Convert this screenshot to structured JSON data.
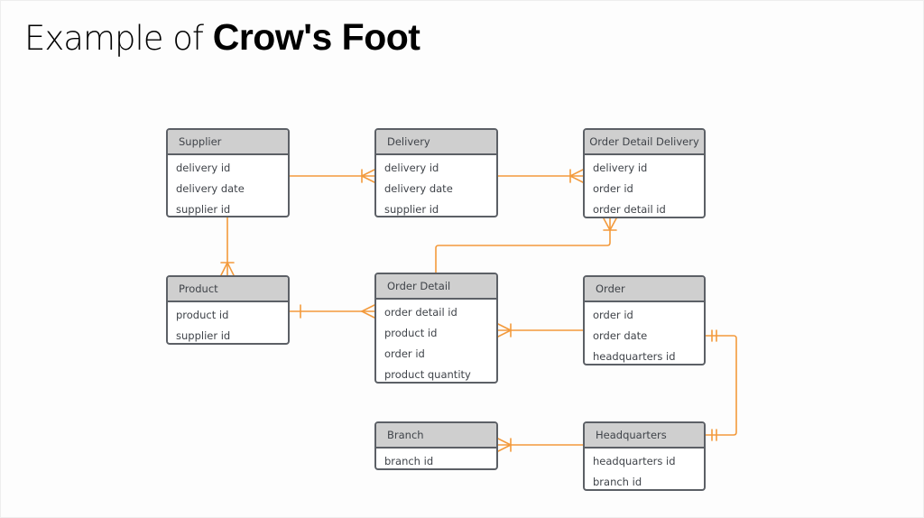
{
  "title": {
    "prefix": "Example of ",
    "emphasis": "Crow's Foot"
  },
  "colors": {
    "connector": "#f39a3c",
    "entity_border": "#5c6066",
    "entity_header_bg": "#cfcfcf",
    "text": "#3f4349"
  },
  "entities": {
    "supplier": {
      "name": "Supplier",
      "attributes": [
        "delivery id",
        "delivery date",
        "supplier id"
      ]
    },
    "delivery": {
      "name": "Delivery",
      "attributes": [
        "delivery id",
        "delivery date",
        "supplier id"
      ]
    },
    "order_detail_delivery": {
      "name": "Order Detail Delivery",
      "attributes": [
        "delivery id",
        "order id",
        "order detail id"
      ]
    },
    "product": {
      "name": "Product",
      "attributes": [
        "product id",
        "supplier id"
      ]
    },
    "order_detail": {
      "name": "Order Detail",
      "attributes": [
        "order detail id",
        "product id",
        "order id",
        "product quantity"
      ]
    },
    "order": {
      "name": "Order",
      "attributes": [
        "order id",
        "order date",
        "headquarters id"
      ]
    },
    "branch": {
      "name": "Branch",
      "attributes": [
        "branch id"
      ]
    },
    "headquarters": {
      "name": "Headquarters",
      "attributes": [
        "headquarters id",
        "branch id"
      ]
    }
  },
  "relationships": [
    {
      "from": "Supplier",
      "to": "Delivery",
      "from_end": "none",
      "to_end": "one-or-many"
    },
    {
      "from": "Delivery",
      "to": "Order Detail Delivery",
      "from_end": "none",
      "to_end": "one-or-many"
    },
    {
      "from": "Supplier",
      "to": "Product",
      "from_end": "none",
      "to_end": "one-or-many"
    },
    {
      "from": "Product",
      "to": "Order Detail",
      "from_end": "one",
      "to_end": "many"
    },
    {
      "from": "Order Detail",
      "to": "Order Detail Delivery",
      "from_end": "none",
      "to_end": "one-or-many"
    },
    {
      "from": "Order",
      "to": "Order Detail",
      "from_end": "none",
      "to_end": "one-or-many"
    },
    {
      "from": "Order",
      "to": "Headquarters",
      "from_end": "one-and-only-one",
      "to_end": "one-and-only-one"
    },
    {
      "from": "Headquarters",
      "to": "Branch",
      "from_end": "none",
      "to_end": "one-or-many"
    }
  ]
}
